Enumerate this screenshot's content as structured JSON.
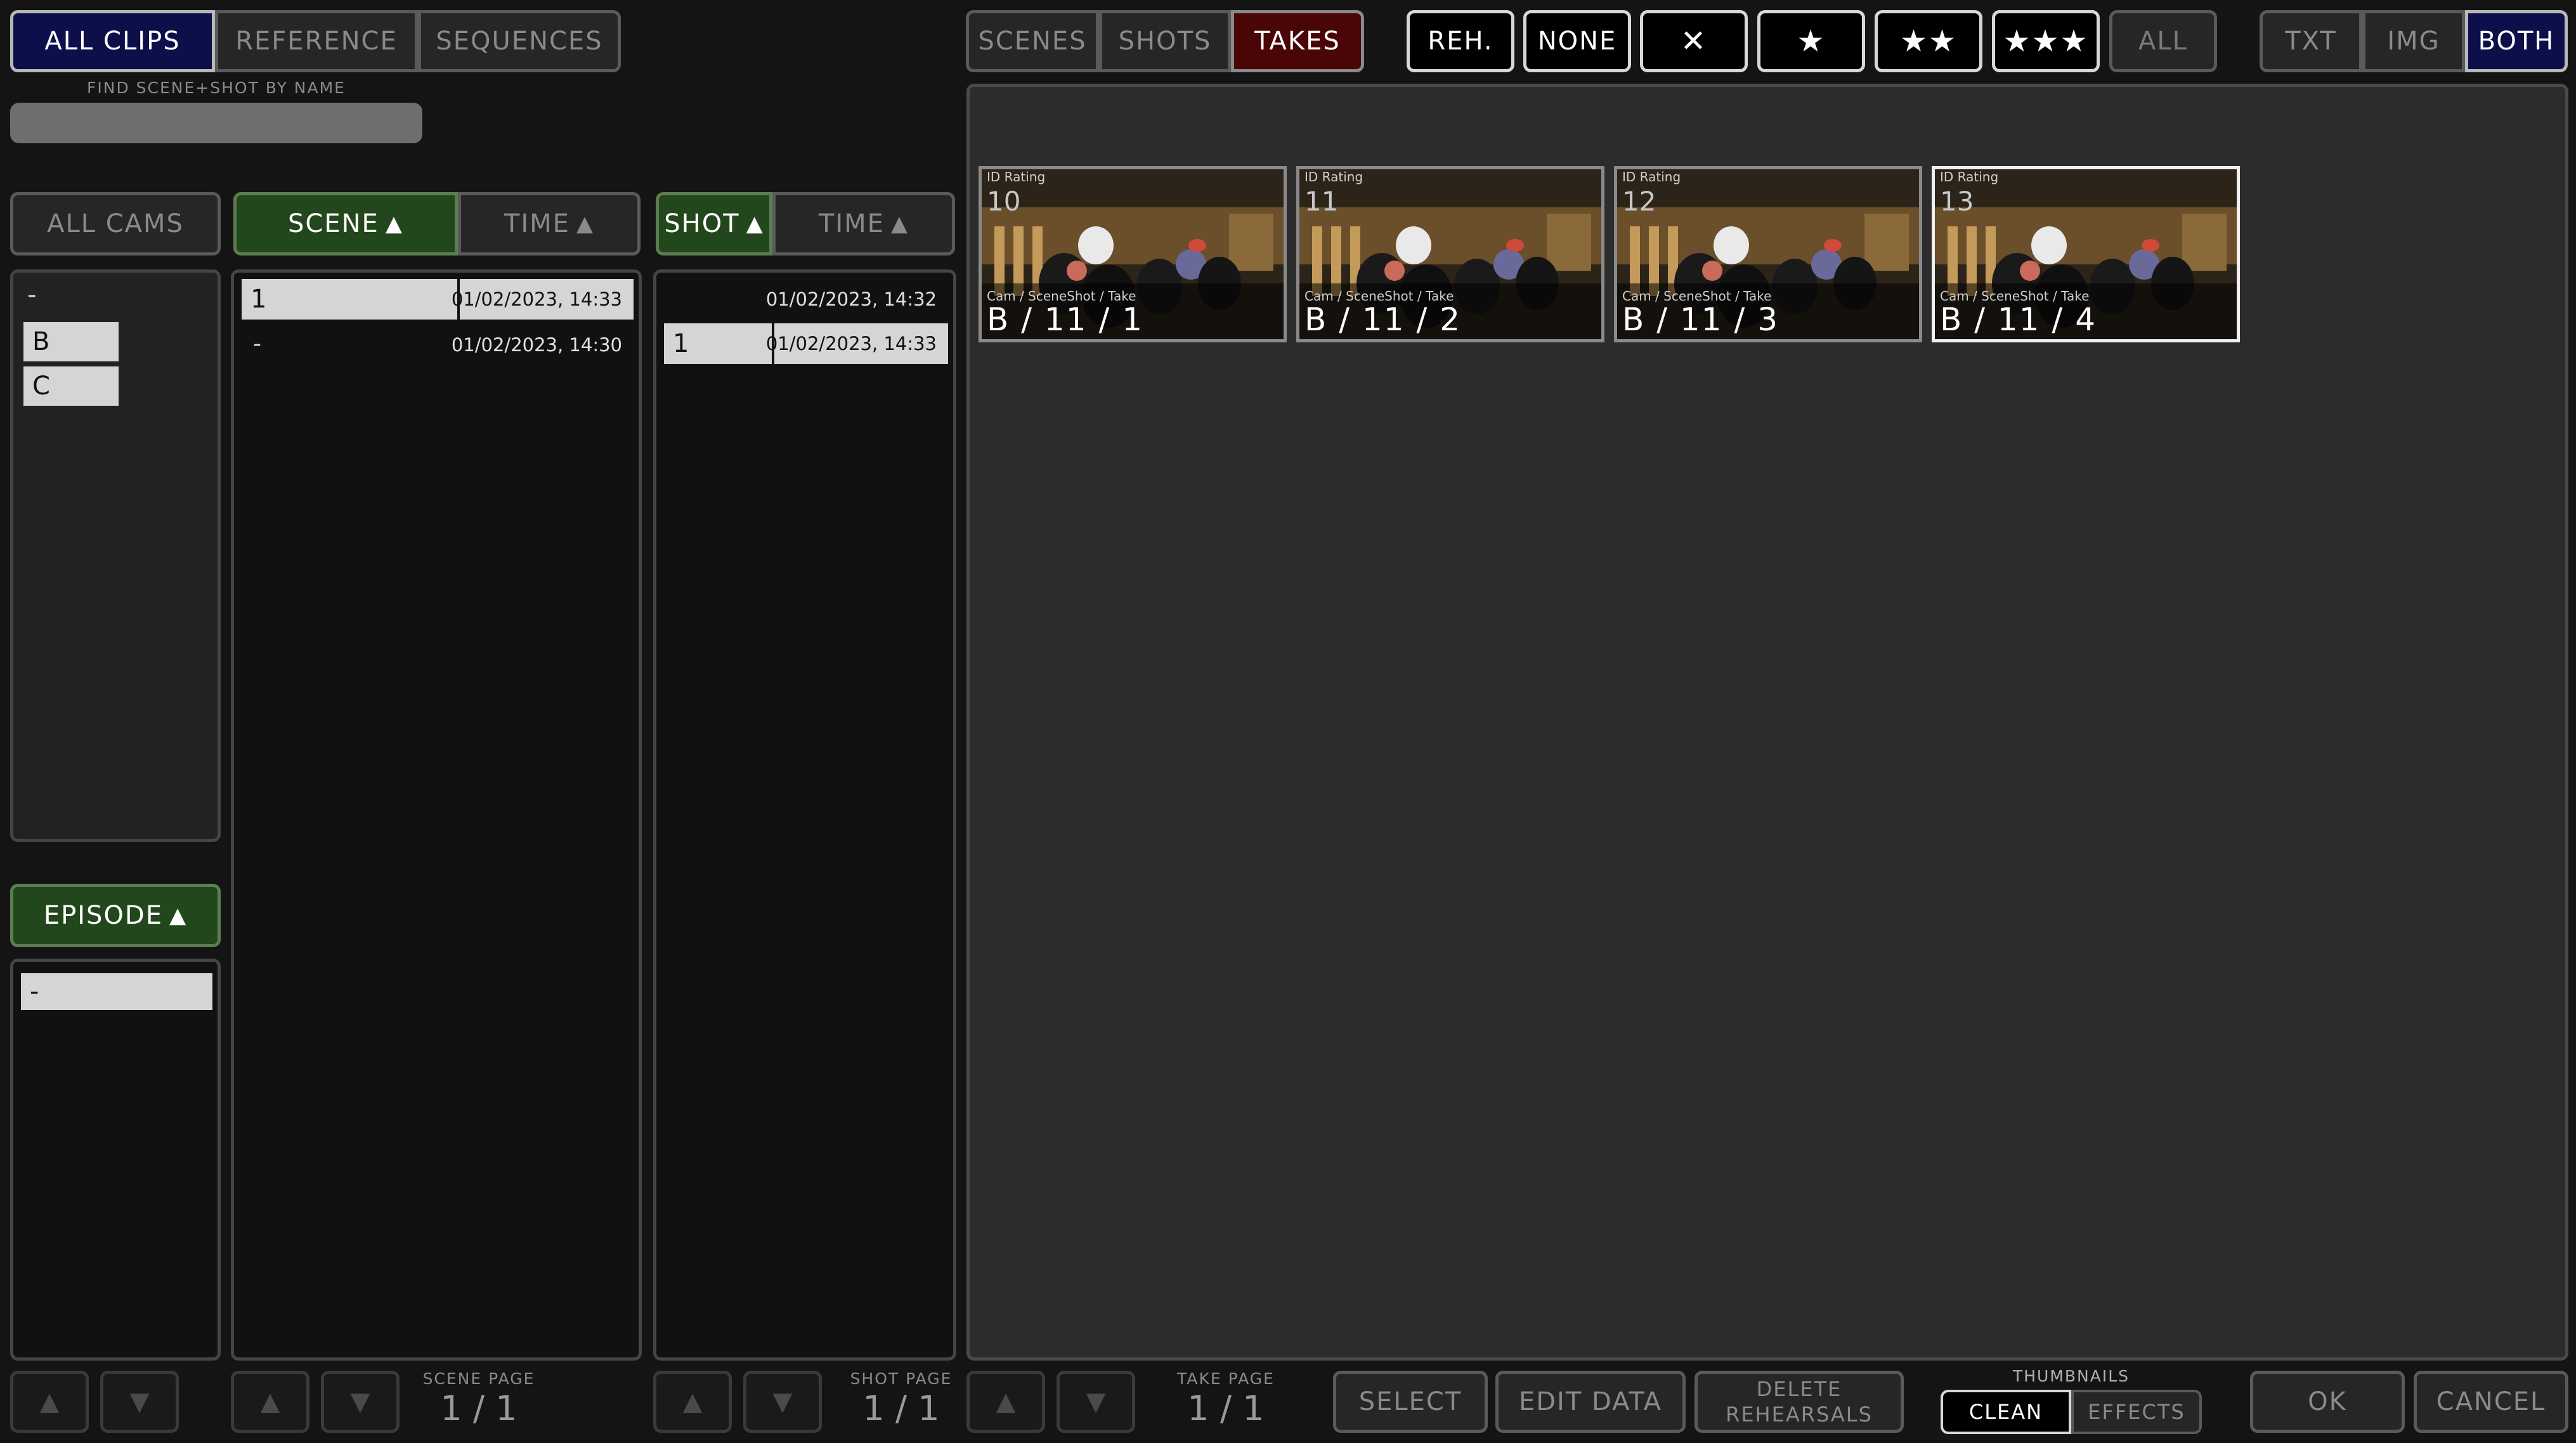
{
  "top_tabs": [
    "ALL CLIPS",
    "REFERENCE",
    "SEQUENCES"
  ],
  "search": {
    "label": "FIND SCENE+SHOT BY NAME",
    "value": ""
  },
  "view_tabs": [
    "SCENES",
    "SHOTS",
    "TAKES"
  ],
  "rating_filters": [
    "REH.",
    "NONE",
    "✕",
    "★",
    "★★",
    "★★★",
    "ALL"
  ],
  "display_modes": [
    "TXT",
    "IMG",
    "BOTH"
  ],
  "cams": {
    "all_label": "ALL CAMS",
    "items": [
      "-",
      "B",
      "C"
    ]
  },
  "episode": {
    "header": "EPISODE",
    "items": [
      "-"
    ]
  },
  "scene_list": {
    "sort_scene": "SCENE",
    "sort_time": "TIME",
    "rows": [
      {
        "name": "1",
        "time": "01/02/2023, 14:33"
      },
      {
        "name": "-",
        "time": "01/02/2023, 14:30"
      }
    ],
    "page_label": "SCENE PAGE",
    "page": "1 / 1"
  },
  "shot_list": {
    "sort_shot": "SHOT",
    "sort_time": "TIME",
    "rows": [
      {
        "name": "",
        "time": "01/02/2023, 14:32"
      },
      {
        "name": "1",
        "time": "01/02/2023, 14:33"
      }
    ],
    "page_label": "SHOT PAGE",
    "page": "1 / 1"
  },
  "takes": [
    {
      "id_label": "ID Rating",
      "id": "10",
      "cs_label": "Cam / SceneShot / Take",
      "cs": "B / 11 / 1"
    },
    {
      "id_label": "ID Rating",
      "id": "11",
      "cs_label": "Cam / SceneShot / Take",
      "cs": "B / 11 / 2"
    },
    {
      "id_label": "ID Rating",
      "id": "12",
      "cs_label": "Cam / SceneShot / Take",
      "cs": "B / 11 / 3"
    },
    {
      "id_label": "ID Rating",
      "id": "13",
      "cs_label": "Cam / SceneShot / Take",
      "cs": "B / 11 / 4"
    }
  ],
  "take_page": {
    "label": "TAKE PAGE",
    "page": "1 / 1"
  },
  "actions": {
    "select": "SELECT",
    "edit_data": "EDIT DATA",
    "delete_line1": "DELETE",
    "delete_line2": "REHEARSALS",
    "thumbnails_label": "THUMBNAILS",
    "clean": "CLEAN",
    "effects": "EFFECTS",
    "ok": "OK",
    "cancel": "CANCEL"
  },
  "colors": {
    "active_blue": "#0c0f4a",
    "active_red": "#4a0606",
    "active_green": "#23471c"
  }
}
